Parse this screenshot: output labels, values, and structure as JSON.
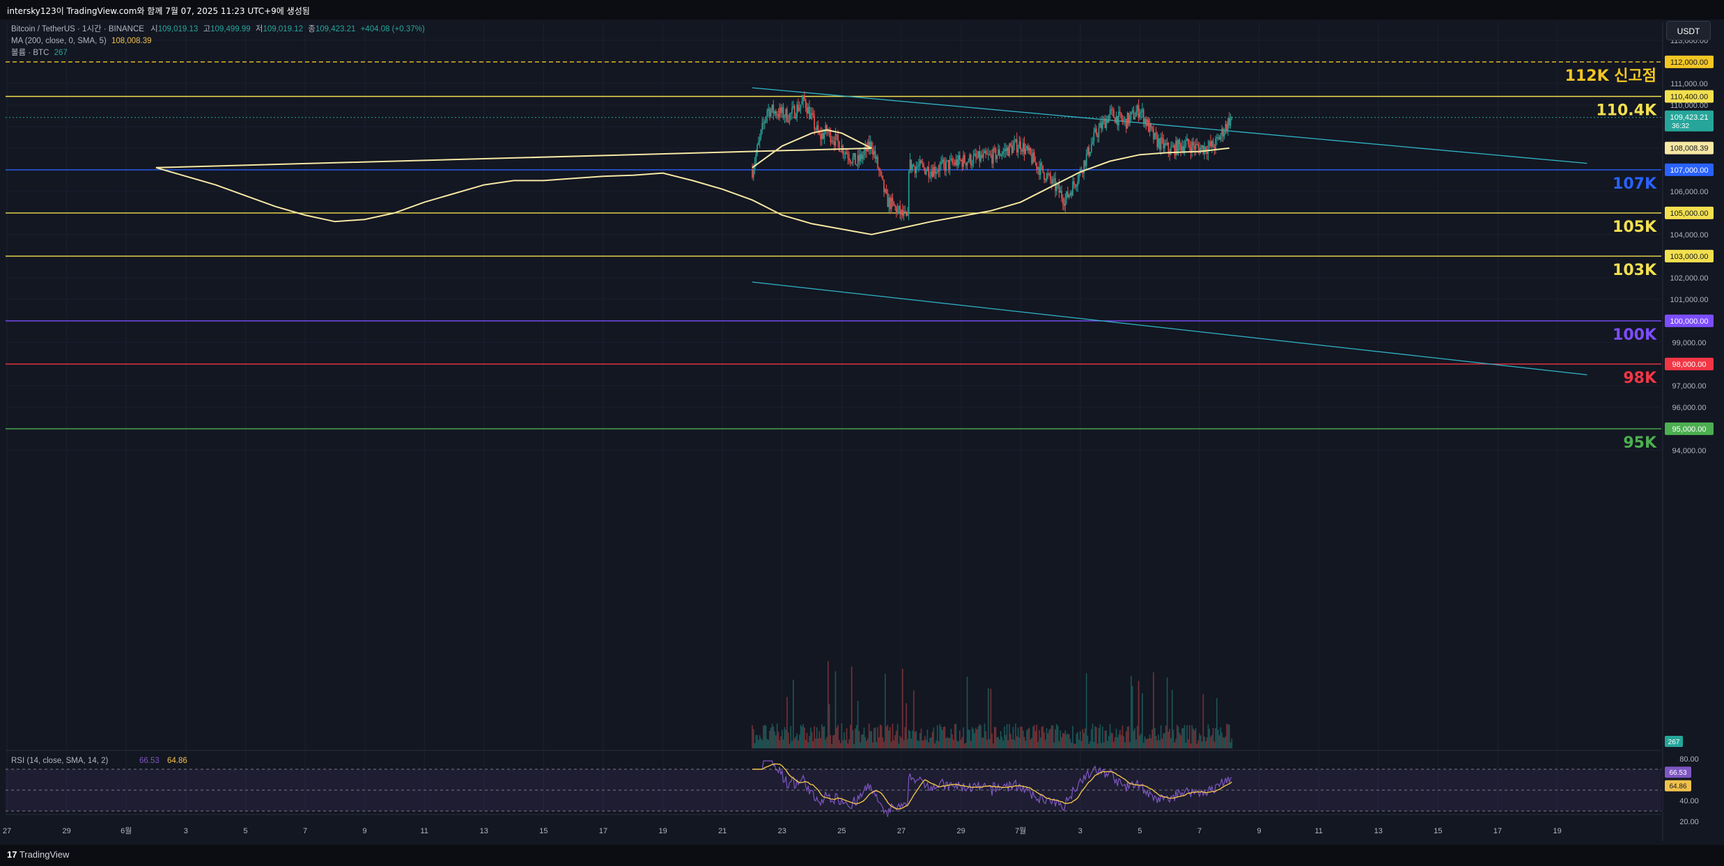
{
  "header": {
    "caption": "intersky123이 TradingView.com와 함께 7월 07, 2025 11:23 UTC+9에 생성됨"
  },
  "legend": {
    "symbol": "Bitcoin / TetherUS · 1시간 · BINANCE",
    "open_label": "시",
    "open": "109,019.13",
    "high_label": "고",
    "high": "109,499.99",
    "low_label": "저",
    "low": "109,019.12",
    "close_label": "종",
    "close": "109,423.21",
    "change": "+404.08 (+0.37%)",
    "ma_label": "MA (200, close, 0, SMA, 5)",
    "ma_value": "108,008.39",
    "volume_label": "볼륨 · BTC",
    "volume_value": "267"
  },
  "toolbar": {
    "currency": "USDT"
  },
  "colors": {
    "background": "#131722",
    "up": "#26a69a",
    "down": "#ef5350",
    "ma": "#f7e8a4",
    "channel": "#2fb7c9",
    "rsi": "#7e57c2",
    "rsi_ma": "#f0c14b",
    "yellow_level": "#f3e04f",
    "blue_level": "#2962ff",
    "purple_level": "#7c4dff",
    "red_level": "#f23645",
    "green_level": "#4caf50"
  },
  "price_axis": {
    "ticks": [
      "113,000.00",
      "111,000.00",
      "110,000.00",
      "106,000.00",
      "104,000.00",
      "102,000.00",
      "101,000.00",
      "99,000.00",
      "97,000.00",
      "96,000.00",
      "94,000.00"
    ],
    "tick_values": [
      113000,
      111000,
      110000,
      106000,
      104000,
      102000,
      101000,
      99000,
      97000,
      96000,
      94000
    ],
    "current_price": "109,423.21",
    "countdown": "36:32",
    "ma_tag": "108,008.39",
    "volume_tag": "267"
  },
  "levels": [
    {
      "price": 112000,
      "tag": "112,000.00",
      "label": "112K 신고점",
      "color": "#f3c623",
      "dashed": true
    },
    {
      "price": 110400,
      "tag": "110,400.00",
      "label": "110.4K",
      "color": "#f3e04f",
      "dashed": false
    },
    {
      "price": 107000,
      "tag": "107,000.00",
      "label": "107K",
      "color": "#2962ff",
      "dashed": false
    },
    {
      "price": 105000,
      "tag": "105,000.00",
      "label": "105K",
      "color": "#f3e04f",
      "dashed": false
    },
    {
      "price": 103000,
      "tag": "103,000.00",
      "label": "103K",
      "color": "#f3e04f",
      "dashed": false
    },
    {
      "price": 100000,
      "tag": "100,000.00",
      "label": "100K",
      "color": "#7c4dff",
      "dashed": false
    },
    {
      "price": 98000,
      "tag": "98,000.00",
      "label": "98K",
      "color": "#f23645",
      "dashed": false
    },
    {
      "price": 95000,
      "tag": "95,000.00",
      "label": "95K",
      "color": "#4caf50",
      "dashed": false
    }
  ],
  "rsi": {
    "label": "RSI (14, close, SMA, 14, 2)",
    "value": "66.53",
    "ma_value": "64.86",
    "ticks": [
      "80.00",
      "40.00",
      "20.00"
    ],
    "tick_values": [
      80,
      40,
      20
    ]
  },
  "time_axis": {
    "labels": [
      "27",
      "29",
      "6월",
      "3",
      "5",
      "7",
      "9",
      "11",
      "13",
      "15",
      "17",
      "19",
      "21",
      "23",
      "25",
      "27",
      "29",
      "7월",
      "3",
      "5",
      "7",
      "9",
      "11",
      "13",
      "15",
      "17",
      "19"
    ],
    "days": [
      -4,
      -2,
      0,
      2,
      4,
      6,
      8,
      10,
      12,
      14,
      16,
      18,
      20,
      22,
      24,
      26,
      28,
      30,
      32,
      34,
      36,
      38,
      40,
      42,
      44,
      46,
      48
    ]
  },
  "chart_data": {
    "type": "candlestick",
    "x_unit": "day (hourly candles)",
    "x_start": "May 26",
    "last_candle": "Jul 7",
    "ylim": [
      93000,
      114000
    ],
    "channel_upper": {
      "from": {
        "day": "May 26",
        "price": 110800
      },
      "to": {
        "day": "Jul 19",
        "price": 107300
      }
    },
    "channel_lower": {
      "from": {
        "day": "May 26",
        "price": 101800
      },
      "to": {
        "day": "Jul 19",
        "price": 97500
      }
    },
    "close_waypoints": [
      {
        "date": "May 26",
        "close": 107000
      },
      {
        "date": "May 26 12h",
        "close": 109800
      },
      {
        "date": "May 27 6h",
        "close": 109500
      },
      {
        "date": "May 27 18h",
        "close": 110200
      },
      {
        "date": "May 28 6h",
        "close": 108500
      },
      {
        "date": "May 28 12h",
        "close": 108800
      },
      {
        "date": "May 29 12h",
        "close": 107300
      },
      {
        "date": "May 30",
        "close": 108200
      },
      {
        "date": "May 30 12h",
        "close": 105600
      },
      {
        "date": "May 31 6h",
        "close": 104600
      },
      {
        "date": "Jun 1",
        "close": 103700
      },
      {
        "date": "Jun 2",
        "close": 104900
      },
      {
        "date": "Jun 3",
        "close": 105400
      },
      {
        "date": "Jun 3 12h",
        "close": 104200
      },
      {
        "date": "Jun 4",
        "close": 105600
      },
      {
        "date": "Jun 5",
        "close": 104800
      },
      {
        "date": "Jun 5 12h",
        "close": 104400
      },
      {
        "date": "Jun 6",
        "close": 102200
      },
      {
        "date": "Jun 6 6h",
        "close": 101200
      },
      {
        "date": "Jun 7",
        "close": 104500
      },
      {
        "date": "Jun 8",
        "close": 105600
      },
      {
        "date": "Jun 9",
        "close": 106200
      },
      {
        "date": "Jun 9 12h",
        "close": 107800
      },
      {
        "date": "Jun 10",
        "close": 110200
      },
      {
        "date": "Jun 10 12h",
        "close": 109100
      },
      {
        "date": "Jun 11",
        "close": 110000
      },
      {
        "date": "Jun 11 12h",
        "close": 108800
      },
      {
        "date": "Jun 12 12h",
        "close": 107600
      },
      {
        "date": "Jun 13",
        "close": 106600
      },
      {
        "date": "Jun 13 6h",
        "close": 103900
      },
      {
        "date": "Jun 14",
        "close": 105100
      },
      {
        "date": "Jun 15",
        "close": 105600
      },
      {
        "date": "Jun 15 12h",
        "close": 104900
      },
      {
        "date": "Jun 16",
        "close": 106000
      },
      {
        "date": "Jun 16 12h",
        "close": 105700
      },
      {
        "date": "Jun 17",
        "close": 106800
      },
      {
        "date": "Jun 17 12h",
        "close": 108000
      },
      {
        "date": "Jun 18",
        "close": 105300
      },
      {
        "date": "Jun 18 12h",
        "close": 104200
      },
      {
        "date": "Jun 19",
        "close": 104800
      },
      {
        "date": "Jun 20",
        "close": 104600
      },
      {
        "date": "Jun 20 12h",
        "close": 104300
      },
      {
        "date": "Jun 21",
        "close": 106000
      },
      {
        "date": "Jun 21 6h",
        "close": 103700
      },
      {
        "date": "Jun 21 18h",
        "close": 102800
      },
      {
        "date": "Jun 22",
        "close": 103400
      },
      {
        "date": "Jun 22 12h",
        "close": 101000
      },
      {
        "date": "Jun 22 18h",
        "close": 98800
      },
      {
        "date": "Jun 23",
        "close": 99500
      },
      {
        "date": "Jun 23 6h",
        "close": 100800
      },
      {
        "date": "Jun 23 12h",
        "close": 100500
      },
      {
        "date": "Jun 24",
        "close": 105000
      },
      {
        "date": "Jun 24 12h",
        "close": 105800
      },
      {
        "date": "Jun 25",
        "close": 107200
      },
      {
        "date": "Jun 25 12h",
        "close": 107800
      },
      {
        "date": "Jun 26",
        "close": 107300
      },
      {
        "date": "Jun 27",
        "close": 107000
      },
      {
        "date": "Jun 28",
        "close": 107400
      },
      {
        "date": "Jun 29",
        "close": 107600
      },
      {
        "date": "Jun 30",
        "close": 108200
      },
      {
        "date": "Jun 30 12h",
        "close": 107300
      },
      {
        "date": "Jul 1",
        "close": 106500
      },
      {
        "date": "Jul 1 12h",
        "close": 105600
      },
      {
        "date": "Jul 2",
        "close": 106900
      },
      {
        "date": "Jul 2 12h",
        "close": 108600
      },
      {
        "date": "Jul 3",
        "close": 109600
      },
      {
        "date": "Jul 3 12h",
        "close": 109200
      },
      {
        "date": "Jul 4",
        "close": 109800
      },
      {
        "date": "Jul 4 12h",
        "close": 108400
      },
      {
        "date": "Jul 5",
        "close": 107900
      },
      {
        "date": "Jul 5 12h",
        "close": 108200
      },
      {
        "date": "Jul 6",
        "close": 108000
      },
      {
        "date": "Jul 6 12h",
        "close": 108100
      },
      {
        "date": "Jul 7",
        "close": 109300
      },
      {
        "date": "Jul 7 2h",
        "close": 109423
      }
    ],
    "ma200_waypoints": [
      {
        "date": "May 26",
        "ma": 107100
      },
      {
        "date": "May 27",
        "ma": 108100
      },
      {
        "date": "May 28",
        "ma": 108700
      },
      {
        "date": "May 28 12h",
        "ma": 108850
      },
      {
        "date": "May 29",
        "ma": 108700
      },
      {
        "date": "May 30",
        "ma": 108000
      },
      {
        "date": "Jun 1",
        "ma": 107100
      },
      {
        "date": "Jun 3",
        "ma": 106300
      },
      {
        "date": "Jun 5",
        "ma": 105300
      },
      {
        "date": "Jun 6",
        "ma": 104900
      },
      {
        "date": "Jun 7",
        "ma": 104600
      },
      {
        "date": "Jun 8",
        "ma": 104700
      },
      {
        "date": "Jun 9",
        "ma": 105000
      },
      {
        "date": "Jun 10",
        "ma": 105500
      },
      {
        "date": "Jun 11",
        "ma": 105900
      },
      {
        "date": "Jun 12",
        "ma": 106300
      },
      {
        "date": "Jun 13",
        "ma": 106500
      },
      {
        "date": "Jun 14",
        "ma": 106500
      },
      {
        "date": "Jun 15",
        "ma": 106600
      },
      {
        "date": "Jun 16",
        "ma": 106700
      },
      {
        "date": "Jun 17",
        "ma": 106750
      },
      {
        "date": "Jun 18",
        "ma": 106850
      },
      {
        "date": "Jun 19",
        "ma": 106500
      },
      {
        "date": "Jun 20",
        "ma": 106100
      },
      {
        "date": "Jun 21",
        "ma": 105600
      },
      {
        "date": "Jun 22",
        "ma": 104900
      },
      {
        "date": "Jun 23",
        "ma": 104500
      },
      {
        "date": "Jun 24",
        "ma": 104250
      },
      {
        "date": "Jun 25",
        "ma": 104000
      },
      {
        "date": "Jun 26",
        "ma": 104300
      },
      {
        "date": "Jun 27",
        "ma": 104600
      },
      {
        "date": "Jun 28",
        "ma": 104850
      },
      {
        "date": "Jun 29",
        "ma": 105100
      },
      {
        "date": "Jun 30",
        "ma": 105500
      },
      {
        "date": "Jul 1",
        "ma": 106200
      },
      {
        "date": "Jul 2",
        "ma": 106900
      },
      {
        "date": "Jul 3",
        "ma": 107400
      },
      {
        "date": "Jul 4",
        "ma": 107700
      },
      {
        "date": "Jul 5",
        "ma": 107800
      },
      {
        "date": "Jul 6",
        "ma": 107850
      },
      {
        "date": "Jul 7",
        "ma": 108008
      }
    ]
  }
}
